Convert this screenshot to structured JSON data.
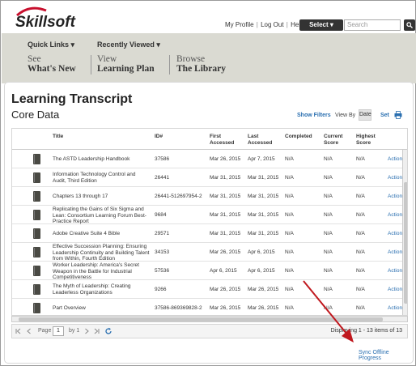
{
  "header": {
    "logo_text": "Skillsoft",
    "my_profile": "My Profile",
    "log_out": "Log Out",
    "help": "Help",
    "select_label": "Select ▾",
    "search_placeholder": "Search"
  },
  "nav": {
    "quick_links": "Quick Links ▾",
    "recently_viewed": "Recently Viewed ▾",
    "links": [
      {
        "top": "See",
        "bottom": "What's New"
      },
      {
        "top": "View",
        "bottom": "Learning Plan"
      },
      {
        "top": "Browse",
        "bottom": "The Library"
      }
    ]
  },
  "page": {
    "title": "Learning Transcript",
    "subtitle": "Core Data",
    "show_filters": "Show Filters",
    "view_by": "View By",
    "date_btn": "Date",
    "set": "Set"
  },
  "table": {
    "columns": [
      "Title",
      "ID#",
      "First Accessed",
      "Last Accessed",
      "Completed",
      "Current Score",
      "Highest Score"
    ],
    "rows": [
      {
        "title": "The ASTD Leadership Handbook",
        "id": "37586",
        "first": "Mar 26, 2015",
        "last": "Apr 7, 2015",
        "completed": "N/A",
        "current": "N/A",
        "highest": "N/A",
        "action": "Actions"
      },
      {
        "title": "Information Technology Control and Audit, Third Edition",
        "id": "26441",
        "first": "Mar 31, 2015",
        "last": "Mar 31, 2015",
        "completed": "N/A",
        "current": "N/A",
        "highest": "N/A",
        "action": "Actions"
      },
      {
        "title": "Chapters 13 through 17",
        "id": "26441-512697954-2",
        "first": "Mar 31, 2015",
        "last": "Mar 31, 2015",
        "completed": "N/A",
        "current": "N/A",
        "highest": "N/A",
        "action": "Actions"
      },
      {
        "title": "Replicating the Gains of Six Sigma and Lean: Consortium Learning Forum Best-Practice Report",
        "id": "9684",
        "first": "Mar 31, 2015",
        "last": "Mar 31, 2015",
        "completed": "N/A",
        "current": "N/A",
        "highest": "N/A",
        "action": "Actions"
      },
      {
        "title": "Adobe Creative Suite 4 Bible",
        "id": "29571",
        "first": "Mar 31, 2015",
        "last": "Mar 31, 2015",
        "completed": "N/A",
        "current": "N/A",
        "highest": "N/A",
        "action": "Actions"
      },
      {
        "title": "Effective Succession Planning: Ensuring Leadership Continuity and Building Talent from Within, Fourth Edition",
        "id": "34153",
        "first": "Mar 26, 2015",
        "last": "Apr 6, 2015",
        "completed": "N/A",
        "current": "N/A",
        "highest": "N/A",
        "action": "Actions"
      },
      {
        "title": "Worker Leadership: America's Secret Weapon in the Battle for Industrial Competitiveness",
        "id": "57536",
        "first": "Apr 6, 2015",
        "last": "Apr 6, 2015",
        "completed": "N/A",
        "current": "N/A",
        "highest": "N/A",
        "action": "Actions"
      },
      {
        "title": "The Myth of Leadership: Creating Leaderless Organizations",
        "id": "9266",
        "first": "Mar 26, 2015",
        "last": "Mar 26, 2015",
        "completed": "N/A",
        "current": "N/A",
        "highest": "N/A",
        "action": "Actions"
      },
      {
        "title": "Part Overview",
        "id": "37586-869369828-2",
        "first": "Mar 26, 2015",
        "last": "Mar 26, 2015",
        "completed": "N/A",
        "current": "N/A",
        "highest": "N/A",
        "action": "Actions"
      }
    ]
  },
  "pager": {
    "page_label": "Page",
    "page_value": "1",
    "of_label": "by 1",
    "displaying": "Displaying 1 - 13 items of 13"
  },
  "sync_link": "Sync Offline Progress",
  "colors": {
    "link": "#2a6fb0",
    "nav_band": "#dadad2",
    "logo_red": "#c8102e",
    "arrow": "#c0181e"
  }
}
